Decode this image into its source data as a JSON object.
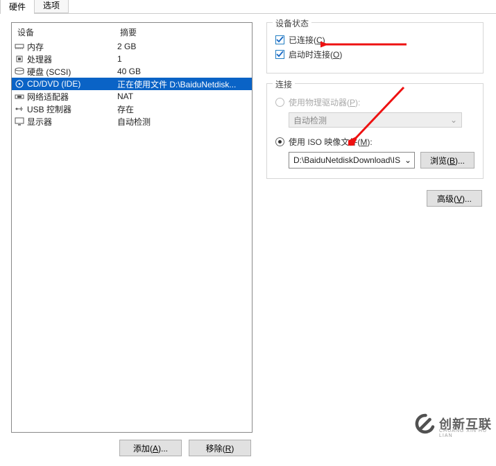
{
  "tabs": {
    "hardware": "硬件",
    "options": "选项"
  },
  "headers": {
    "device": "设备",
    "summary": "摘要"
  },
  "devices": [
    {
      "icon": "memory-icon",
      "name": "内存",
      "summary": "2 GB",
      "selected": false
    },
    {
      "icon": "cpu-icon",
      "name": "处理器",
      "summary": "1",
      "selected": false
    },
    {
      "icon": "hdd-icon",
      "name": "硬盘 (SCSI)",
      "summary": "40 GB",
      "selected": false
    },
    {
      "icon": "cd-icon",
      "name": "CD/DVD (IDE)",
      "summary": "正在使用文件 D:\\BaiduNetdisk...",
      "selected": true
    },
    {
      "icon": "nic-icon",
      "name": "网络适配器",
      "summary": "NAT",
      "selected": false
    },
    {
      "icon": "usb-icon",
      "name": "USB 控制器",
      "summary": "存在",
      "selected": false
    },
    {
      "icon": "display-icon",
      "name": "显示器",
      "summary": "自动检测",
      "selected": false
    }
  ],
  "buttons": {
    "add": "添加(A)...",
    "remove": "移除(R)",
    "browse": "浏览(B)...",
    "advanced": "高级(V)..."
  },
  "status_group": {
    "title": "设备状态",
    "connected": "已连接(C)",
    "connect_at_power_on": "启动时连接(O)"
  },
  "connection_group": {
    "title": "连接",
    "use_physical": "使用物理驱动器(P):",
    "auto_detect": "自动检测",
    "use_iso": "使用 ISO 映像文件(M):",
    "iso_path": "D:\\BaiduNetdiskDownload\\IS"
  },
  "watermark": {
    "main": "创新互联",
    "sub": "CHUANG XIN HU LIAN"
  }
}
